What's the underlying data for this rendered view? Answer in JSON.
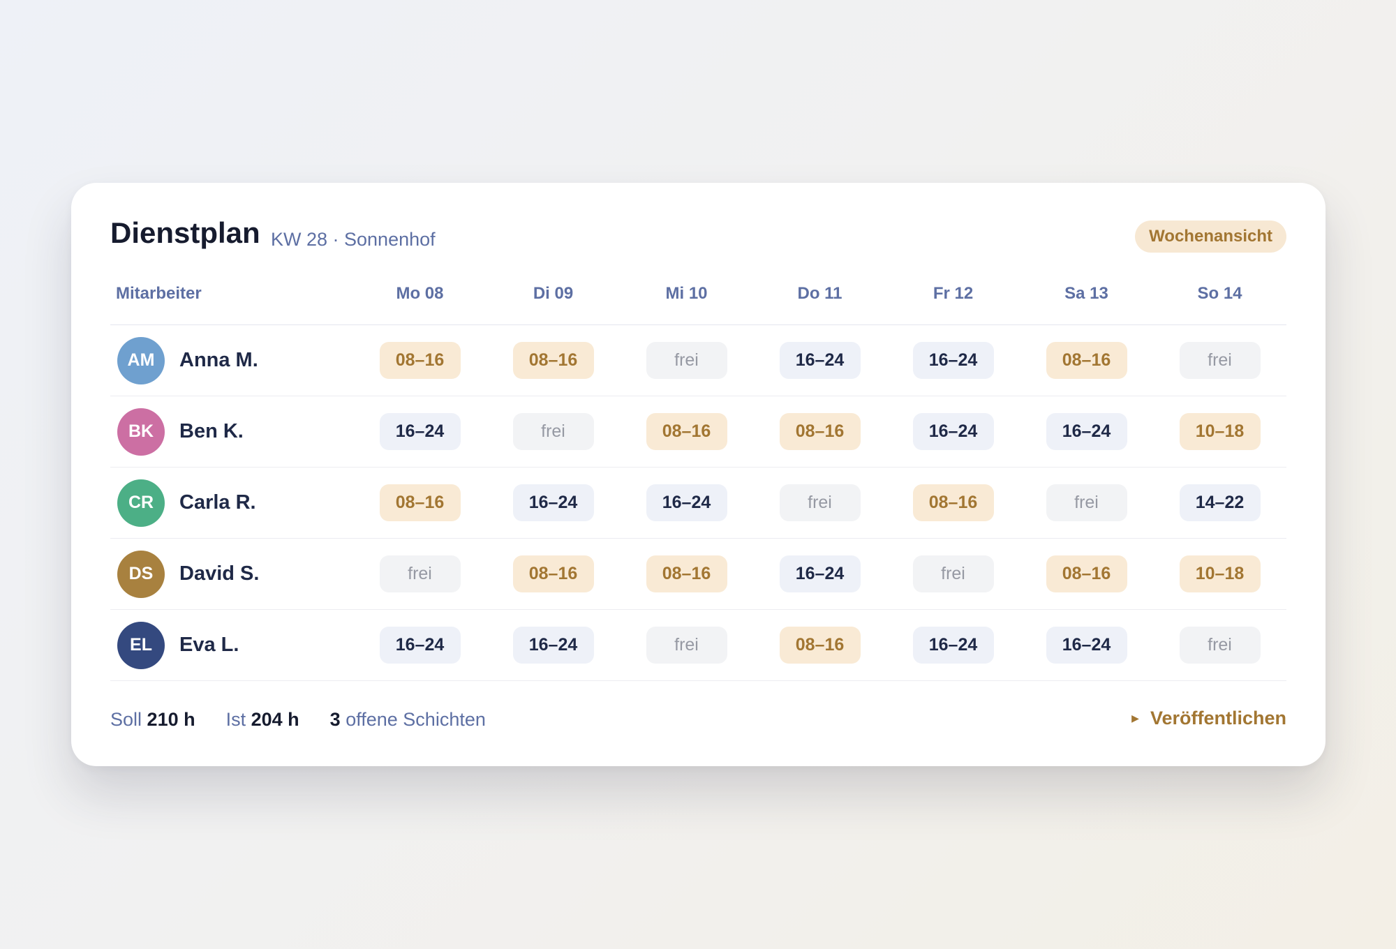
{
  "header": {
    "title": "Dienstplan",
    "subtitle": "KW 28 · Sonnenhof",
    "view_label": "Wochenansicht"
  },
  "table": {
    "employee_header": "Mitarbeiter",
    "days": [
      "Mo 08",
      "Di 09",
      "Mi 10",
      "Do 11",
      "Fr 12",
      "Sa 13",
      "So 14"
    ],
    "rows": [
      {
        "initials": "AM",
        "name": "Anna M.",
        "avatar_color": "#6fa0cf",
        "shifts": [
          "08–16",
          "08–16",
          "frei",
          "16–24",
          "16–24",
          "08–16",
          "frei"
        ]
      },
      {
        "initials": "BK",
        "name": "Ben K.",
        "avatar_color": "#cc6fa3",
        "shifts": [
          "16–24",
          "frei",
          "08–16",
          "08–16",
          "16–24",
          "16–24",
          "10–18"
        ]
      },
      {
        "initials": "CR",
        "name": "Carla R.",
        "avatar_color": "#4caf86",
        "shifts": [
          "08–16",
          "16–24",
          "16–24",
          "frei",
          "08–16",
          "frei",
          "14–22"
        ]
      },
      {
        "initials": "DS",
        "name": "David S.",
        "avatar_color": "#a8813f",
        "shifts": [
          "frei",
          "08–16",
          "08–16",
          "16–24",
          "frei",
          "08–16",
          "10–18"
        ]
      },
      {
        "initials": "EL",
        "name": "Eva L.",
        "avatar_color": "#34497f",
        "shifts": [
          "16–24",
          "16–24",
          "frei",
          "08–16",
          "16–24",
          "16–24",
          "frei"
        ]
      }
    ]
  },
  "footer": {
    "soll_label": "Soll",
    "soll_value": "210 h",
    "ist_label": "Ist",
    "ist_value": "204 h",
    "open_count": "3",
    "open_label": "offene Schichten",
    "publish_label": "Veröffentlichen"
  },
  "colors": {
    "early_shift_bg": "#f9ead5",
    "early_shift_text": "#a27632",
    "late_shift_bg": "#eef1f8",
    "late_shift_text": "#1f2947",
    "off_bg": "#f2f3f5",
    "off_text": "#9699a3",
    "accent": "#5d6fa3"
  }
}
